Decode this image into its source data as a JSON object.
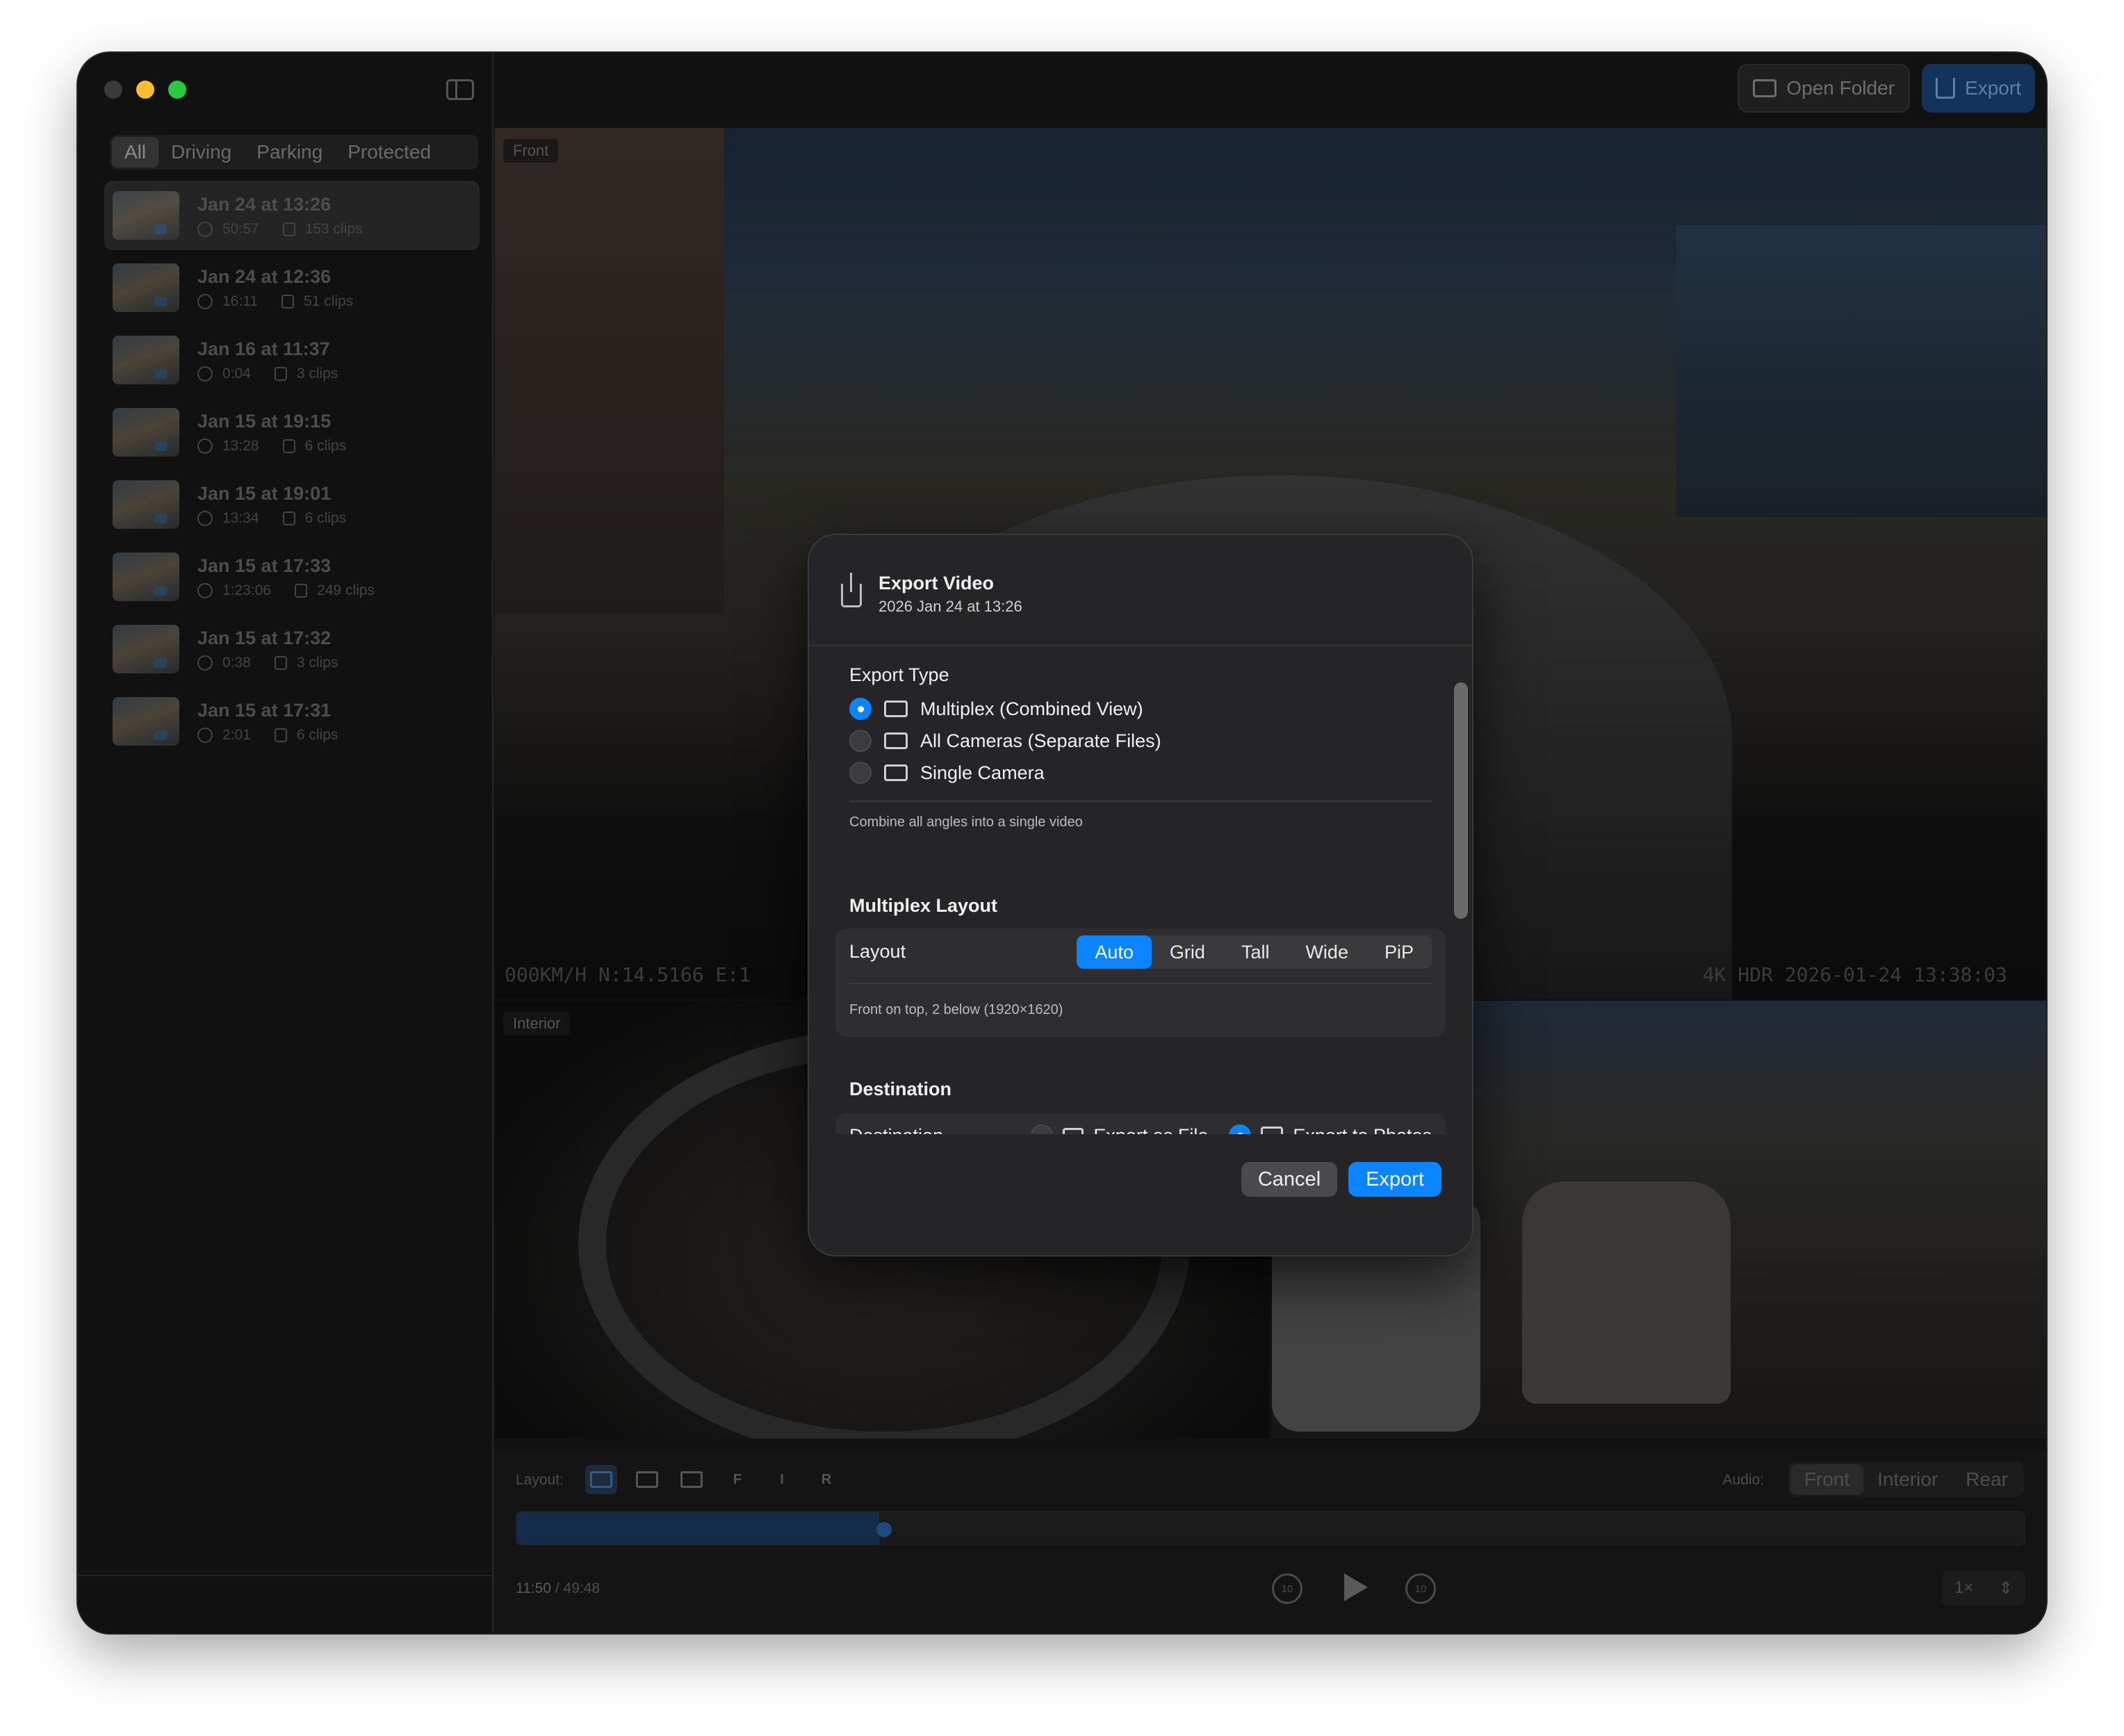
{
  "sidebar": {
    "filters": [
      "All",
      "Driving",
      "Parking",
      "Protected"
    ],
    "selected_filter": "All",
    "clips": [
      {
        "title": "Jan 24 at 13:26",
        "duration": "50:57",
        "count": "153 clips",
        "selected": true
      },
      {
        "title": "Jan 24 at 12:36",
        "duration": "16:11",
        "count": "51 clips"
      },
      {
        "title": "Jan 16 at 11:37",
        "duration": "0:04",
        "count": "3 clips"
      },
      {
        "title": "Jan 15 at 19:15",
        "duration": "13:28",
        "count": "6 clips"
      },
      {
        "title": "Jan 15 at 19:01",
        "duration": "13:34",
        "count": "6 clips"
      },
      {
        "title": "Jan 15 at 17:33",
        "duration": "1:23:06",
        "count": "249 clips"
      },
      {
        "title": "Jan 15 at 17:32",
        "duration": "0:38",
        "count": "3 clips"
      },
      {
        "title": "Jan 15 at 17:31",
        "duration": "2:01",
        "count": "6 clips"
      }
    ]
  },
  "toolbar": {
    "open_folder": "Open Folder",
    "export": "Export"
  },
  "cameras": {
    "front": {
      "label": "Front",
      "overlay_left": "000KM/H N:14.5166 E:1",
      "overlay_right": "4K HDR 2026-01-24 13:38:03"
    },
    "interior": {
      "label": "Interior"
    }
  },
  "controls": {
    "layout_label": "Layout:",
    "layout_letters": [
      "F",
      "I",
      "R"
    ],
    "audio_label": "Audio:",
    "audio_options": [
      "Front",
      "Interior",
      "Rear"
    ],
    "current_time": "11:50",
    "total_time": "49:48",
    "progress": 0.24,
    "skip_back": "10",
    "skip_forward": "10",
    "speed": "1×"
  },
  "dialog": {
    "title": "Export Video",
    "subtitle": "2026 Jan 24 at 13:26",
    "export_type_title": "Export Type",
    "export_types": [
      {
        "label": "Multiplex (Combined View)",
        "selected": true
      },
      {
        "label": "All Cameras (Separate Files)",
        "selected": false
      },
      {
        "label": "Single Camera",
        "selected": false
      }
    ],
    "export_type_hint": "Combine all angles into a single video",
    "multiplex_title": "Multiplex Layout",
    "layout_label": "Layout",
    "layout_options": [
      "Auto",
      "Grid",
      "Tall",
      "Wide",
      "PiP"
    ],
    "layout_selected": "Auto",
    "layout_hint": "Front on top, 2 below (1920×1620)",
    "destination_title": "Destination",
    "destination_label": "Destination",
    "destination_options": [
      {
        "label": "Export as File",
        "selected": false
      },
      {
        "label": "Export to Photos",
        "selected": true
      }
    ],
    "cancel": "Cancel",
    "export": "Export"
  },
  "colors": {
    "accent": "#0a84ff",
    "traffic_red": "#ff5f57",
    "traffic_yellow": "#febc2e",
    "traffic_green": "#28c840"
  }
}
